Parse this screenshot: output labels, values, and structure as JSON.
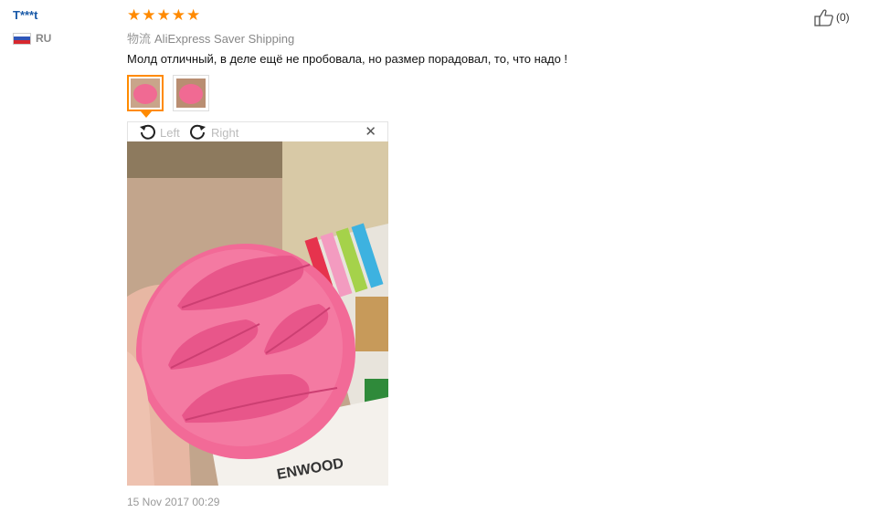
{
  "reviewer": {
    "name": "T***t",
    "country_code": "RU",
    "flag_icon": "russia-flag-icon"
  },
  "rating": {
    "stars": 5,
    "star_color": "#ff8a00"
  },
  "shipping": {
    "label": "物流",
    "method": "AliExpress Saver Shipping"
  },
  "review": {
    "text": "Молд отличный, в деле ещё не пробовала, но размер порадовал, то, что надо !"
  },
  "viewer": {
    "rotate_left_label": "Left",
    "rotate_right_label": "Right",
    "close_icon": "close-icon"
  },
  "photo": {
    "text": "ENWOOD"
  },
  "date": "15 Nov 2017 00:29",
  "helpful": {
    "count_label": "(0)",
    "icon": "thumbs-up-icon"
  }
}
